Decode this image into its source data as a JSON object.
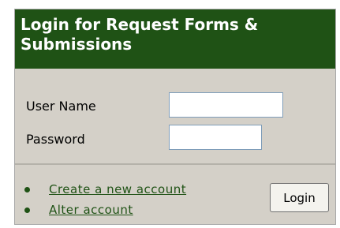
{
  "header": {
    "title_line1": "Login for Request Forms &",
    "title_line2": "Submissions"
  },
  "form": {
    "username_label": "User Name",
    "username_value": "",
    "password_label": "Password",
    "password_value": ""
  },
  "links": [
    {
      "label": "Create a new account"
    },
    {
      "label": "Alter account"
    }
  ],
  "login_button": {
    "label": "Login"
  },
  "colors": {
    "header_bg": "#1f5215",
    "panel_bg": "#d4d0c8",
    "link": "#1f5215"
  },
  "icons": {
    "bullet": "bullet-icon"
  }
}
